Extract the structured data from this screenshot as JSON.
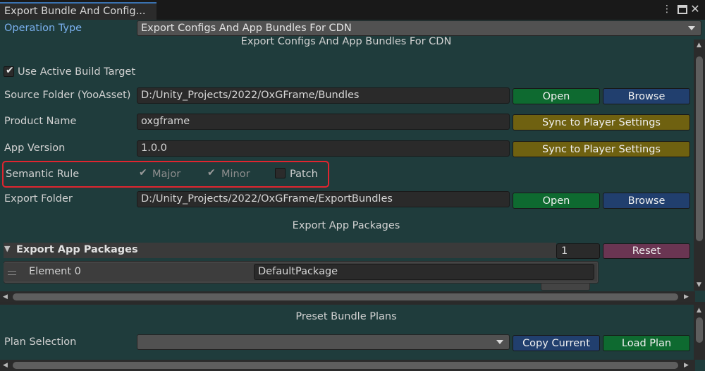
{
  "window": {
    "tab_title": "Export Bundle And Config...",
    "menu_icon": "kebab-menu-icon",
    "maximize_icon": "maximize-icon",
    "close_icon": "close-icon"
  },
  "operation_type": {
    "label": "Operation Type",
    "value": "Export Configs And App Bundles For CDN",
    "section_title": "Export Configs And App Bundles For CDN"
  },
  "use_active_build_target": {
    "label": "Use Active Build Target",
    "checked": true
  },
  "source_folder": {
    "label": "Source Folder (YooAsset)",
    "value": "D:/Unity_Projects/2022/OxGFrame/Bundles",
    "open_label": "Open",
    "browse_label": "Browse"
  },
  "product_name": {
    "label": "Product Name",
    "value": "oxgframe",
    "sync_label": "Sync to Player Settings"
  },
  "app_version": {
    "label": "App Version",
    "value": "1.0.0",
    "sync_label": "Sync to Player Settings"
  },
  "semantic_rule": {
    "label": "Semantic Rule",
    "major": {
      "label": "Major",
      "checked": true,
      "enabled": false
    },
    "minor": {
      "label": "Minor",
      "checked": true,
      "enabled": false
    },
    "patch": {
      "label": "Patch",
      "checked": false,
      "enabled": true
    }
  },
  "export_folder": {
    "label": "Export Folder",
    "value": "D:/Unity_Projects/2022/OxGFrame/ExportBundles",
    "open_label": "Open",
    "browse_label": "Browse"
  },
  "export_app_packages": {
    "section_title": "Export App Packages",
    "foldout_label": "Export App Packages",
    "count": "1",
    "reset_label": "Reset",
    "elements": [
      {
        "label": "Element 0",
        "value": "DefaultPackage"
      }
    ]
  },
  "preset_bundle_plans": {
    "section_title": "Preset Bundle Plans",
    "plan_selection_label": "Plan Selection",
    "plan_selection_value": "",
    "copy_current_label": "Copy Current",
    "load_plan_label": "Load Plan"
  },
  "colors": {
    "panel_bg": "#1f3c3c",
    "open_button": "#0e6a30",
    "browse_button": "#213f6e",
    "sync_button": "#6f6110",
    "reset_button": "#6a3552",
    "highlight": "#e0252f",
    "operation_label": "#7ab0ee"
  }
}
